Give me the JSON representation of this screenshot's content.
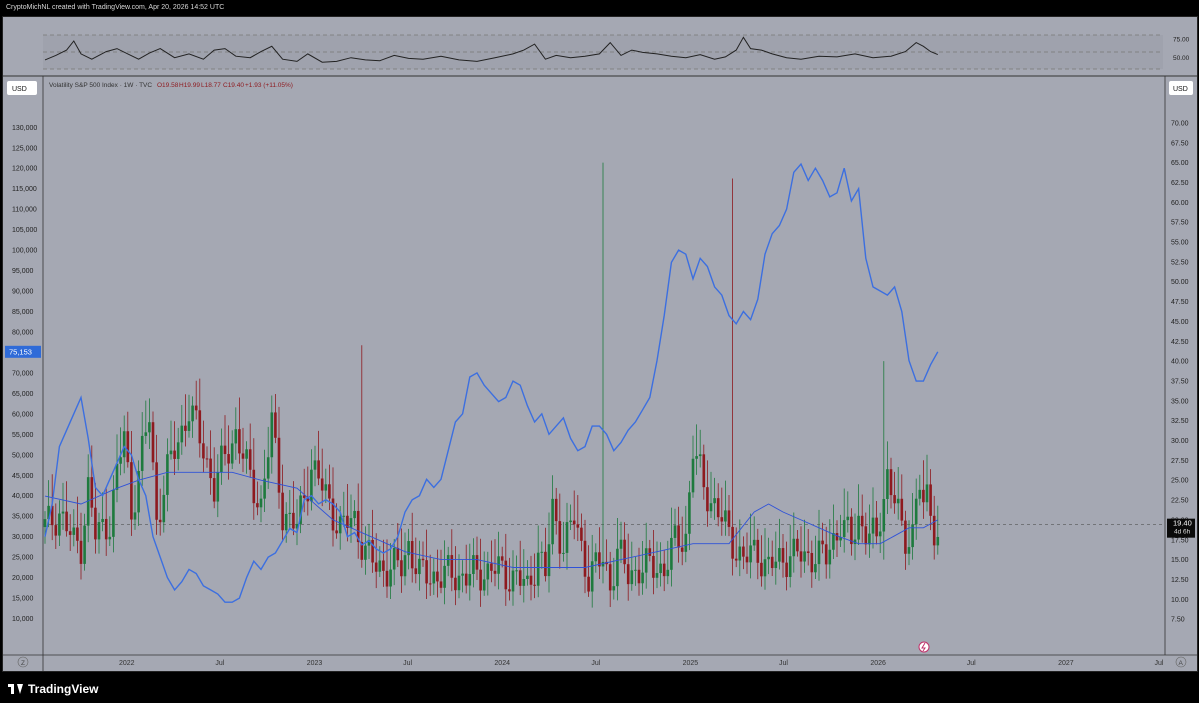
{
  "header": {
    "caption": "CryptoMichNL created with TradingView.com, Apr 20, 2026 14:52 UTC"
  },
  "legend": {
    "symbol": "Volatility S&P 500 Index · 1W · TVC",
    "o": "O19.58",
    "h": "H19.99",
    "l": "L18.77",
    "c": "C19.40",
    "chg": "+1.93 (+11.05%)"
  },
  "left_currency": "USD",
  "right_currency": "USD",
  "auto_label": "A",
  "reset_label": "Z",
  "footer": {
    "brand": "TradingView"
  },
  "colors": {
    "background": "#a5a8b3",
    "up": "#1e7a3e",
    "down": "#8e1a1f",
    "overlay_line": "#3c6fe0",
    "ma_line": "#2f52d8",
    "rsi_line": "#222222"
  },
  "chart_data": {
    "type": "candlestick",
    "title": "Volatility S&P 500 Index · 1W · TVC",
    "x_ticks": [
      "2022",
      "Jul",
      "2023",
      "Jul",
      "2024",
      "Jul",
      "2025",
      "Jul",
      "2026",
      "Jul",
      "2027",
      "Jul"
    ],
    "right_axis": {
      "ticks": [
        "70.00",
        "67.50",
        "65.00",
        "62.50",
        "60.00",
        "57.50",
        "55.00",
        "52.50",
        "50.00",
        "47.50",
        "45.00",
        "42.50",
        "40.00",
        "37.50",
        "35.00",
        "32.50",
        "30.00",
        "27.50",
        "25.00",
        "22.50",
        "20.00",
        "17.50",
        "15.00",
        "12.50",
        "10.00",
        "7.50"
      ],
      "ylim": [
        5,
        71
      ],
      "last_price": "19.40",
      "countdown": "4d 6h"
    },
    "left_axis": {
      "ticks": [
        "130,000",
        "125,000",
        "120,000",
        "115,000",
        "110,000",
        "105,000",
        "100,000",
        "95,000",
        "90,000",
        "85,000",
        "80,000",
        "75,000",
        "70,000",
        "65,000",
        "60,000",
        "55,000",
        "50,000",
        "45,000",
        "40,000",
        "35,000",
        "30,000",
        "25,000",
        "20,000",
        "15,000",
        "10,000"
      ],
      "ylim": [
        5000,
        133000
      ],
      "last_value": "75,153"
    },
    "rsi_ticks": [
      "75.00",
      "50.00"
    ],
    "start_date": "2021-07-26",
    "end_date": "2026-04-20",
    "vix_anchors": [
      [
        0,
        19
      ],
      [
        4,
        21
      ],
      [
        8,
        17
      ],
      [
        10,
        17
      ],
      [
        12,
        24
      ],
      [
        14,
        18
      ],
      [
        18,
        20
      ],
      [
        22,
        31
      ],
      [
        24,
        21
      ],
      [
        26,
        26
      ],
      [
        29,
        33
      ],
      [
        31,
        20
      ],
      [
        34,
        26
      ],
      [
        37,
        30
      ],
      [
        40,
        34
      ],
      [
        44,
        29
      ],
      [
        47,
        24
      ],
      [
        50,
        28
      ],
      [
        53,
        31
      ],
      [
        57,
        25
      ],
      [
        60,
        22
      ],
      [
        63,
        32
      ],
      [
        66,
        21
      ],
      [
        70,
        19
      ],
      [
        74,
        27
      ],
      [
        79,
        22
      ],
      [
        82,
        19
      ],
      [
        86,
        20
      ],
      [
        89,
        16
      ],
      [
        92,
        14
      ],
      [
        95,
        14
      ],
      [
        99,
        14
      ],
      [
        101,
        17
      ],
      [
        104,
        13
      ],
      [
        108,
        13
      ],
      [
        112,
        13
      ],
      [
        116,
        13
      ],
      [
        120,
        13
      ],
      [
        124,
        14
      ],
      [
        128,
        13
      ],
      [
        131,
        13
      ],
      [
        134,
        11
      ],
      [
        137,
        16
      ],
      [
        139,
        13
      ],
      [
        141,
        21
      ],
      [
        144,
        17
      ],
      [
        147,
        20
      ],
      [
        151,
        13
      ],
      [
        155,
        15
      ],
      [
        157,
        12
      ],
      [
        159,
        16
      ],
      [
        162,
        13
      ],
      [
        165,
        14
      ],
      [
        169,
        14
      ],
      [
        172,
        14
      ],
      [
        175,
        17
      ],
      [
        178,
        18
      ],
      [
        180,
        29
      ],
      [
        183,
        24
      ],
      [
        186,
        22
      ],
      [
        190,
        18
      ],
      [
        194,
        15
      ],
      [
        198,
        16
      ],
      [
        201,
        14
      ],
      [
        205,
        15
      ],
      [
        207,
        16
      ],
      [
        211,
        15
      ],
      [
        214,
        16
      ],
      [
        217,
        15
      ],
      [
        221,
        20
      ],
      [
        224,
        17
      ],
      [
        226,
        20
      ],
      [
        228,
        19
      ],
      [
        231,
        17
      ],
      [
        234,
        26
      ],
      [
        236,
        23
      ],
      [
        238,
        18
      ],
      [
        239,
        17
      ],
      [
        241,
        19
      ],
      [
        242,
        23
      ],
      [
        243,
        25
      ],
      [
        244,
        21
      ],
      [
        245,
        22
      ],
      [
        246,
        21
      ],
      [
        247,
        19
      ],
      [
        248,
        18
      ]
    ],
    "vix_spikes": [
      [
        88,
        42,
        17
      ],
      [
        155,
        65,
        12
      ],
      [
        191,
        63,
        13
      ],
      [
        233,
        40,
        15
      ]
    ],
    "overlay_series": [
      [
        0,
        30000
      ],
      [
        2,
        38000
      ],
      [
        4,
        52000
      ],
      [
        6,
        56000
      ],
      [
        8,
        60000
      ],
      [
        10,
        64000
      ],
      [
        12,
        54000
      ],
      [
        14,
        42000
      ],
      [
        16,
        40000
      ],
      [
        18,
        44000
      ],
      [
        20,
        48000
      ],
      [
        22,
        52000
      ],
      [
        24,
        50000
      ],
      [
        26,
        44000
      ],
      [
        28,
        40000
      ],
      [
        30,
        30000
      ],
      [
        32,
        25000
      ],
      [
        34,
        20000
      ],
      [
        36,
        17000
      ],
      [
        38,
        19000
      ],
      [
        40,
        22000
      ],
      [
        42,
        21000
      ],
      [
        44,
        18000
      ],
      [
        46,
        17000
      ],
      [
        48,
        16000
      ],
      [
        50,
        14000
      ],
      [
        52,
        14000
      ],
      [
        54,
        15000
      ],
      [
        56,
        20000
      ],
      [
        58,
        24000
      ],
      [
        60,
        22000
      ],
      [
        62,
        25000
      ],
      [
        64,
        26000
      ],
      [
        66,
        29000
      ],
      [
        68,
        32000
      ],
      [
        70,
        31000
      ],
      [
        72,
        39000
      ],
      [
        74,
        40000
      ],
      [
        76,
        38000
      ],
      [
        78,
        39000
      ],
      [
        80,
        38000
      ],
      [
        82,
        36000
      ],
      [
        84,
        30000
      ],
      [
        86,
        31000
      ],
      [
        88,
        28000
      ],
      [
        90,
        29000
      ],
      [
        92,
        27000
      ],
      [
        94,
        26000
      ],
      [
        96,
        27000
      ],
      [
        98,
        30000
      ],
      [
        100,
        36000
      ],
      [
        102,
        39000
      ],
      [
        104,
        40000
      ],
      [
        106,
        44000
      ],
      [
        108,
        42000
      ],
      [
        110,
        44000
      ],
      [
        112,
        51000
      ],
      [
        114,
        58000
      ],
      [
        116,
        60000
      ],
      [
        118,
        69000
      ],
      [
        120,
        70000
      ],
      [
        122,
        67000
      ],
      [
        124,
        65000
      ],
      [
        126,
        63000
      ],
      [
        128,
        64000
      ],
      [
        130,
        68000
      ],
      [
        132,
        67000
      ],
      [
        134,
        62000
      ],
      [
        136,
        58000
      ],
      [
        138,
        60000
      ],
      [
        140,
        55000
      ],
      [
        142,
        57000
      ],
      [
        144,
        59000
      ],
      [
        146,
        54000
      ],
      [
        148,
        51000
      ],
      [
        150,
        52000
      ],
      [
        152,
        57000
      ],
      [
        154,
        57000
      ],
      [
        156,
        55000
      ],
      [
        158,
        51000
      ],
      [
        160,
        53000
      ],
      [
        162,
        56000
      ],
      [
        164,
        58000
      ],
      [
        166,
        61000
      ],
      [
        168,
        64000
      ],
      [
        170,
        73000
      ],
      [
        172,
        84000
      ],
      [
        174,
        97000
      ],
      [
        176,
        100000
      ],
      [
        178,
        99000
      ],
      [
        180,
        93000
      ],
      [
        182,
        98000
      ],
      [
        184,
        96000
      ],
      [
        186,
        91000
      ],
      [
        188,
        89000
      ],
      [
        190,
        84000
      ],
      [
        192,
        82000
      ],
      [
        194,
        85000
      ],
      [
        196,
        83000
      ],
      [
        198,
        88000
      ],
      [
        200,
        99000
      ],
      [
        202,
        104000
      ],
      [
        204,
        106000
      ],
      [
        206,
        110000
      ],
      [
        208,
        119000
      ],
      [
        210,
        121000
      ],
      [
        212,
        117000
      ],
      [
        214,
        120000
      ],
      [
        216,
        117000
      ],
      [
        218,
        113000
      ],
      [
        220,
        114000
      ],
      [
        222,
        120000
      ],
      [
        224,
        112000
      ],
      [
        226,
        115000
      ],
      [
        228,
        98000
      ],
      [
        230,
        91000
      ],
      [
        232,
        90000
      ],
      [
        234,
        89000
      ],
      [
        236,
        91000
      ],
      [
        238,
        85000
      ],
      [
        240,
        73000
      ],
      [
        242,
        68000
      ],
      [
        244,
        68000
      ],
      [
        246,
        72000
      ],
      [
        248,
        75153
      ]
    ],
    "ma_series": [
      [
        0,
        23
      ],
      [
        10,
        22
      ],
      [
        20,
        24
      ],
      [
        26,
        25
      ],
      [
        34,
        26
      ],
      [
        44,
        26
      ],
      [
        52,
        26
      ],
      [
        60,
        25
      ],
      [
        70,
        24
      ],
      [
        80,
        20
      ],
      [
        90,
        18
      ],
      [
        100,
        16
      ],
      [
        110,
        15
      ],
      [
        120,
        15
      ],
      [
        130,
        14
      ],
      [
        140,
        14
      ],
      [
        150,
        14
      ],
      [
        160,
        15
      ],
      [
        170,
        16
      ],
      [
        180,
        17
      ],
      [
        190,
        17
      ],
      [
        197,
        21
      ],
      [
        201,
        22
      ],
      [
        205,
        21
      ],
      [
        210,
        20
      ],
      [
        215,
        19
      ],
      [
        220,
        18
      ],
      [
        226,
        17
      ],
      [
        232,
        17
      ],
      [
        236,
        18
      ],
      [
        240,
        19
      ],
      [
        244,
        19
      ],
      [
        248,
        20
      ]
    ],
    "rsi_series": [
      [
        0,
        47
      ],
      [
        3,
        53
      ],
      [
        6,
        60
      ],
      [
        8,
        72
      ],
      [
        10,
        55
      ],
      [
        13,
        48
      ],
      [
        17,
        58
      ],
      [
        20,
        62
      ],
      [
        23,
        55
      ],
      [
        26,
        48
      ],
      [
        29,
        56
      ],
      [
        32,
        62
      ],
      [
        36,
        50
      ],
      [
        40,
        55
      ],
      [
        44,
        48
      ],
      [
        47,
        60
      ],
      [
        50,
        62
      ],
      [
        53,
        52
      ],
      [
        57,
        50
      ],
      [
        60,
        58
      ],
      [
        63,
        65
      ],
      [
        66,
        48
      ],
      [
        70,
        45
      ],
      [
        73,
        55
      ],
      [
        77,
        44
      ],
      [
        81,
        45
      ],
      [
        85,
        50
      ],
      [
        89,
        47
      ],
      [
        93,
        46
      ],
      [
        97,
        53
      ],
      [
        101,
        49
      ],
      [
        105,
        48
      ],
      [
        110,
        52
      ],
      [
        115,
        47
      ],
      [
        120,
        45
      ],
      [
        125,
        50
      ],
      [
        130,
        55
      ],
      [
        133,
        60
      ],
      [
        136,
        68
      ],
      [
        139,
        48
      ],
      [
        142,
        53
      ],
      [
        146,
        50
      ],
      [
        150,
        52
      ],
      [
        154,
        55
      ],
      [
        157,
        70
      ],
      [
        160,
        53
      ],
      [
        163,
        60
      ],
      [
        166,
        57
      ],
      [
        170,
        55
      ],
      [
        174,
        52
      ],
      [
        178,
        50
      ],
      [
        182,
        54
      ],
      [
        186,
        48
      ],
      [
        189,
        51
      ],
      [
        192,
        60
      ],
      [
        194,
        77
      ],
      [
        196,
        62
      ],
      [
        199,
        60
      ],
      [
        202,
        55
      ],
      [
        206,
        50
      ],
      [
        210,
        48
      ],
      [
        215,
        52
      ],
      [
        220,
        51
      ],
      [
        225,
        55
      ],
      [
        230,
        50
      ],
      [
        235,
        52
      ],
      [
        239,
        58
      ],
      [
        242,
        70
      ],
      [
        244,
        65
      ],
      [
        246,
        58
      ],
      [
        248,
        54
      ]
    ]
  }
}
